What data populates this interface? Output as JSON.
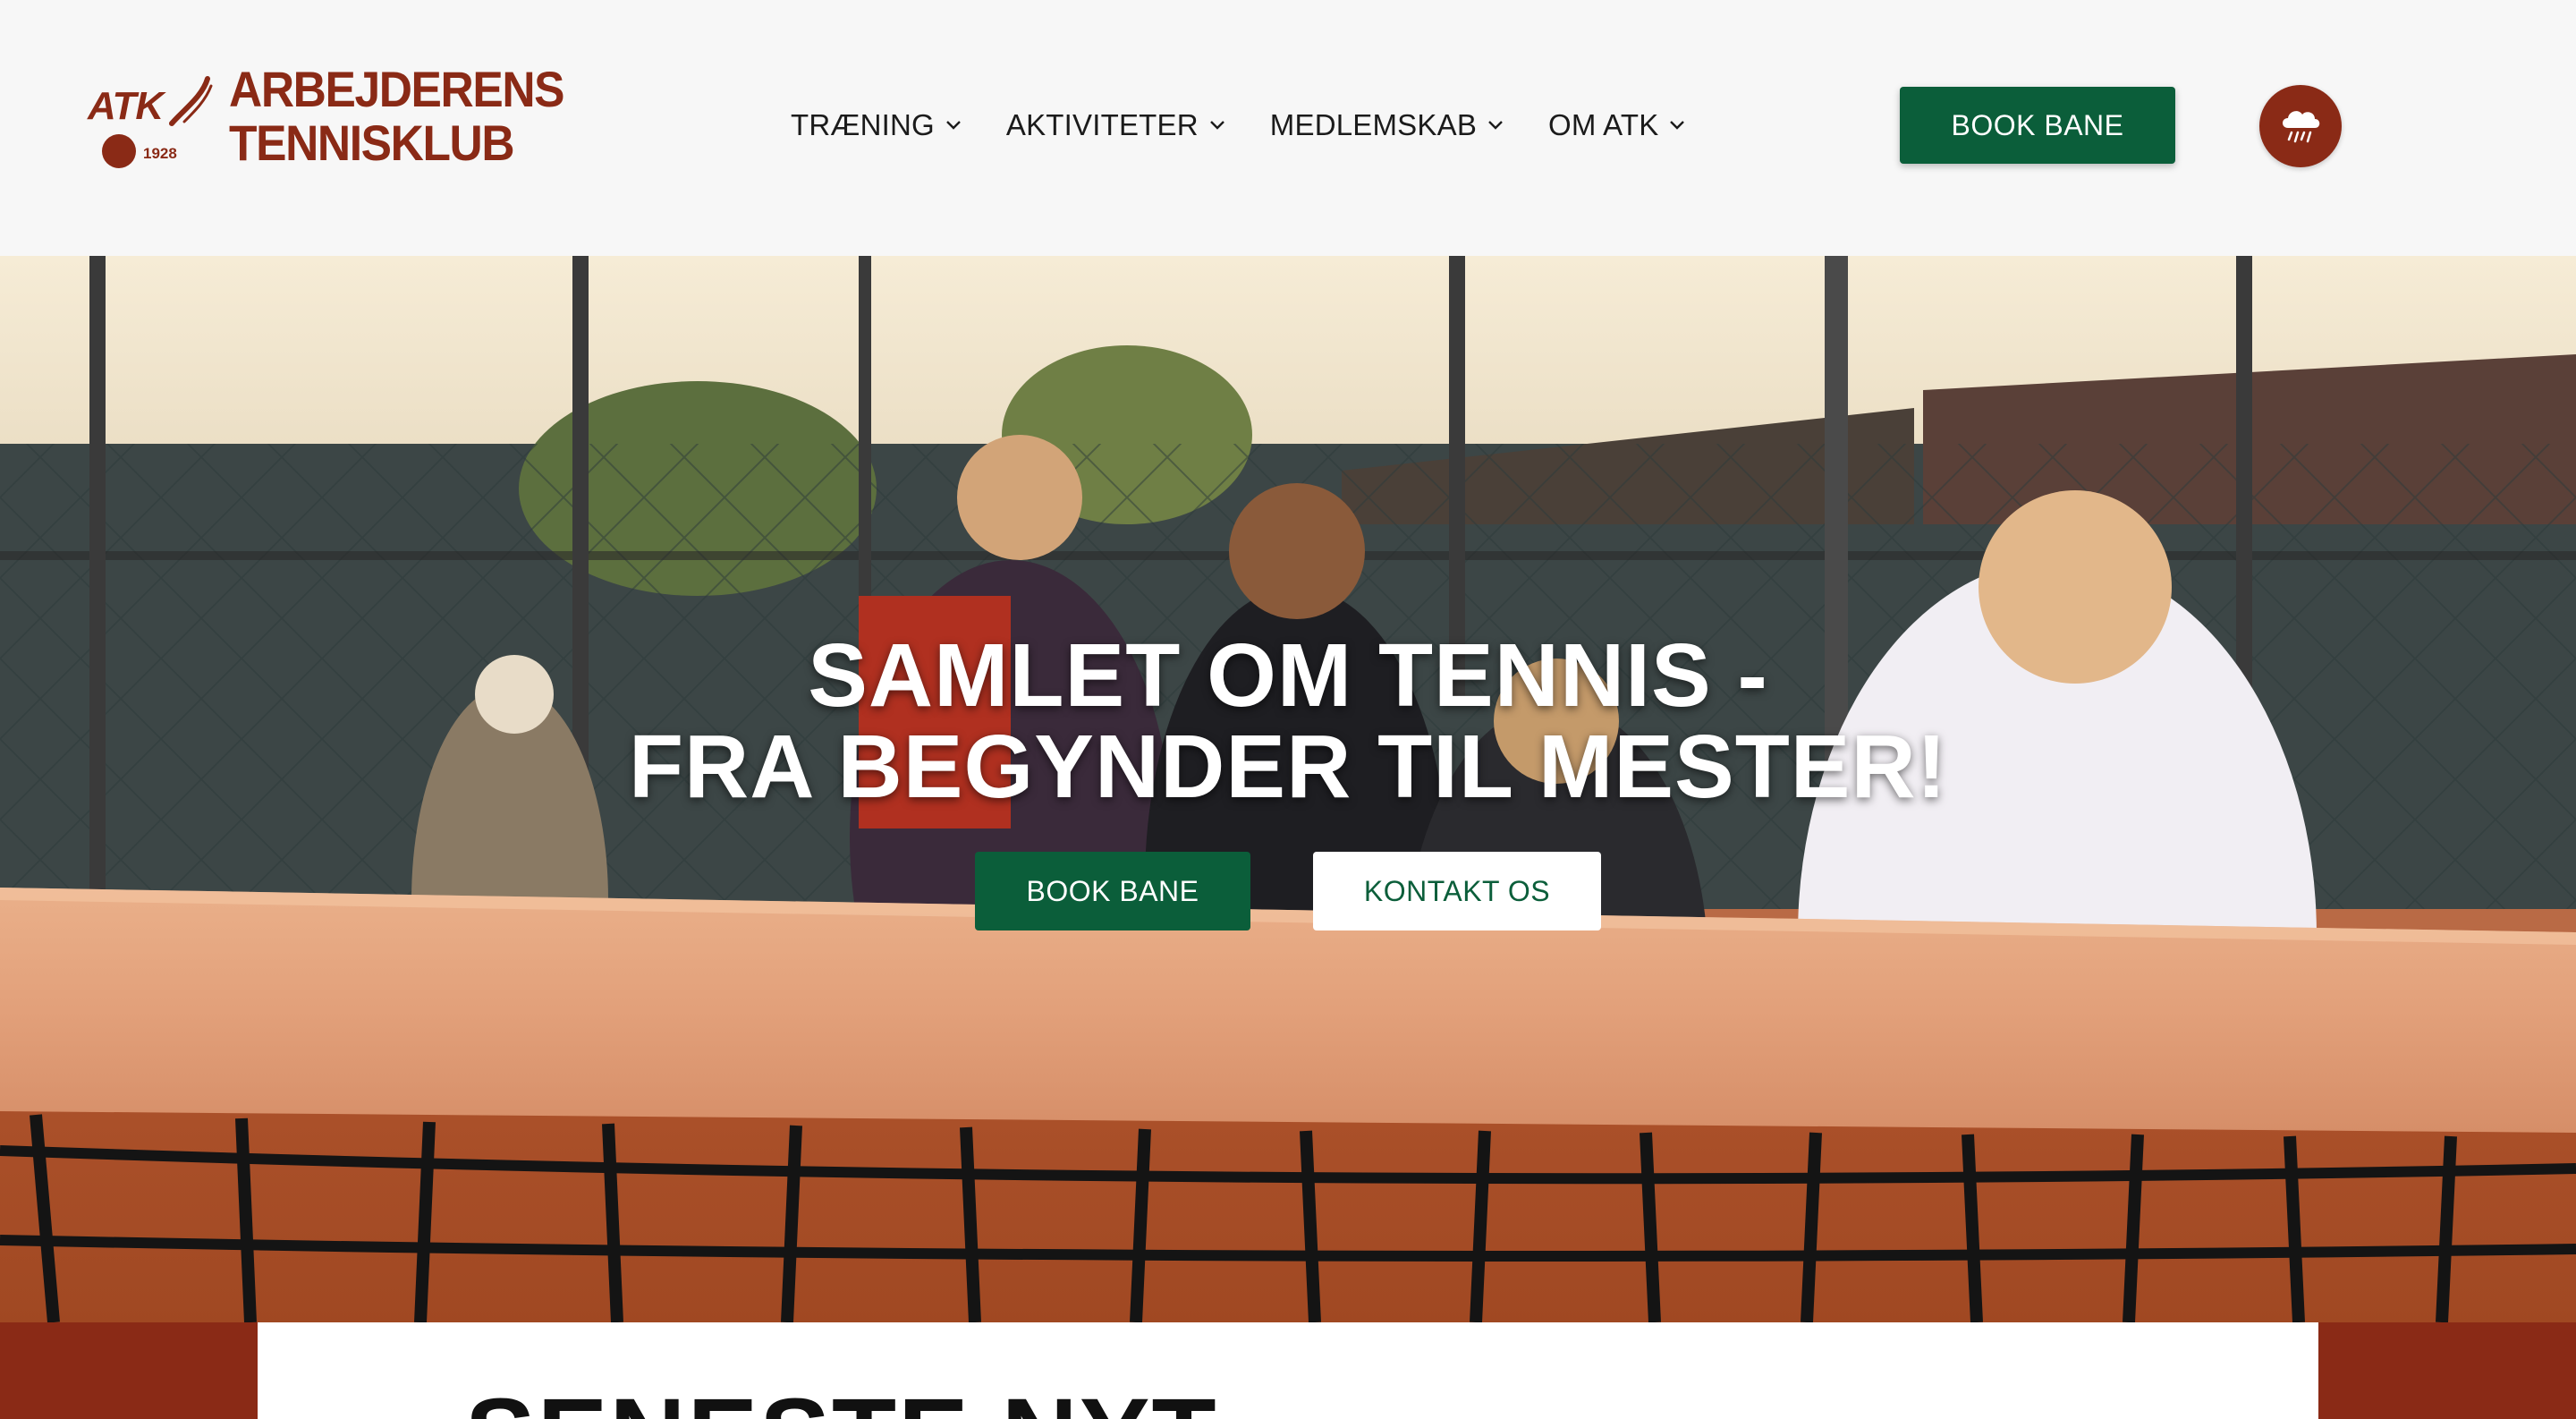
{
  "header": {
    "logo": {
      "mark": "ATK",
      "year": "1928",
      "name_line1": "ARBEJDERENS",
      "name_line2": "TENNISKLUB"
    },
    "nav": [
      {
        "label": "TRÆNING"
      },
      {
        "label": "AKTIVITETER"
      },
      {
        "label": "MEDLEMSKAB"
      },
      {
        "label": "OM ATK"
      }
    ],
    "book_button": "BOOK BANE",
    "weather_icon": "rain-cloud-icon"
  },
  "hero": {
    "title_line1": "SAMLET OM TENNIS -",
    "title_line2": "FRA BEGYNDER TIL MESTER!",
    "book_button": "BOOK BANE",
    "contact_button": "KONTAKT OS"
  },
  "news": {
    "title": "SENESTE NYT"
  },
  "colors": {
    "brand_red": "#8a2a16",
    "brand_green": "#0b5e3a",
    "header_bg": "#f7f7f7"
  }
}
